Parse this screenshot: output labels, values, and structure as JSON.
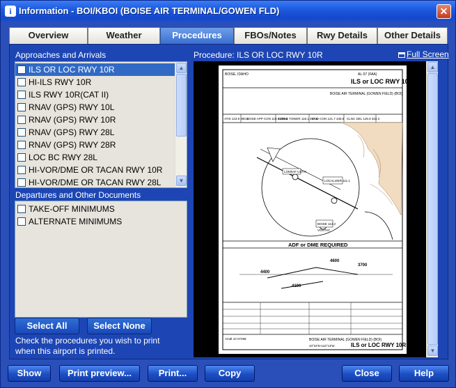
{
  "window": {
    "title": "Information - BOI/KBOI (BOISE AIR TERMINAL/GOWEN FLD)",
    "title_icon": "i",
    "close_label": "✕"
  },
  "tabs": [
    {
      "label": "Overview",
      "active": false
    },
    {
      "label": "Weather",
      "active": false
    },
    {
      "label": "Procedures",
      "active": true
    },
    {
      "label": "FBOs/Notes",
      "active": false
    },
    {
      "label": "Rwy Details",
      "active": false
    },
    {
      "label": "Other Details",
      "active": false
    }
  ],
  "approaches": {
    "heading": "Approaches and Arrivals",
    "items": [
      {
        "label": "ILS OR LOC RWY 10R",
        "selected": true
      },
      {
        "label": "HI-ILS RWY 10R",
        "selected": false
      },
      {
        "label": "ILS RWY 10R(CAT II)",
        "selected": false
      },
      {
        "label": "RNAV (GPS) RWY 10L",
        "selected": false
      },
      {
        "label": "RNAV (GPS) RWY 10R",
        "selected": false
      },
      {
        "label": "RNAV (GPS) RWY 28L",
        "selected": false
      },
      {
        "label": "RNAV (GPS) RWY 28R",
        "selected": false
      },
      {
        "label": "LOC BC RWY 28L",
        "selected": false
      },
      {
        "label": "HI-VOR/DME OR TACAN RWY 10R",
        "selected": false
      },
      {
        "label": "HI-VOR/DME OR TACAN RWY 28L",
        "selected": false
      }
    ]
  },
  "departures": {
    "heading": "Departures and Other Documents",
    "items": [
      {
        "label": "TAKE-OFF MINIMUMS"
      },
      {
        "label": "ALTERNATE MINIMUMS"
      }
    ]
  },
  "selection_buttons": {
    "select_all": "Select All",
    "select_none": "Select None"
  },
  "hint": {
    "line1": "Check the procedures you wish to print",
    "line2": "when this airport is printed."
  },
  "procedure": {
    "label": "Procedure: ILS OR LOC RWY 10R",
    "fullscreen": "Full Screen"
  },
  "chart": {
    "location": "BOISE, IDAHO",
    "ref": "AL-57 (FAA)",
    "name": "ILS or LOC RWY 10R",
    "airport": "BOISE AIR TERMINAL (GOWEN FIELD) (BOI)",
    "freqs": [
      "ATIS 123.9 290.4",
      "BOISE APP CON 119.6 269.4",
      "BOISE TOWER 118.1 257.8",
      "GND CON 121.7 348.6",
      "CLNC DEL 125.9 322.3"
    ],
    "adf": "ADF or DME REQUIRED",
    "fixes": [
      "LOM/IAF USTIK",
      "LOCALIZER 111.1",
      "BOISE 113.3",
      "VORTAC"
    ],
    "altitudes": [
      "4400",
      "4100",
      "4600",
      "3700"
    ],
    "bottom_name": "ILS or LOC RWY 10R",
    "bottom_airport": "BOISE AIR TERMINAL (GOWEN FIELD) (BOI)",
    "coords": "43°34'N-116°13'W",
    "amdt": "Amdt 10 07298"
  },
  "bottom_buttons": {
    "show": "Show",
    "print_preview": "Print preview...",
    "print": "Print...",
    "copy": "Copy",
    "close": "Close",
    "help": "Help"
  },
  "colors": {
    "window_blue": "#2a4fb8",
    "selection": "#316ac5",
    "titlebar": "#1d5be0"
  }
}
